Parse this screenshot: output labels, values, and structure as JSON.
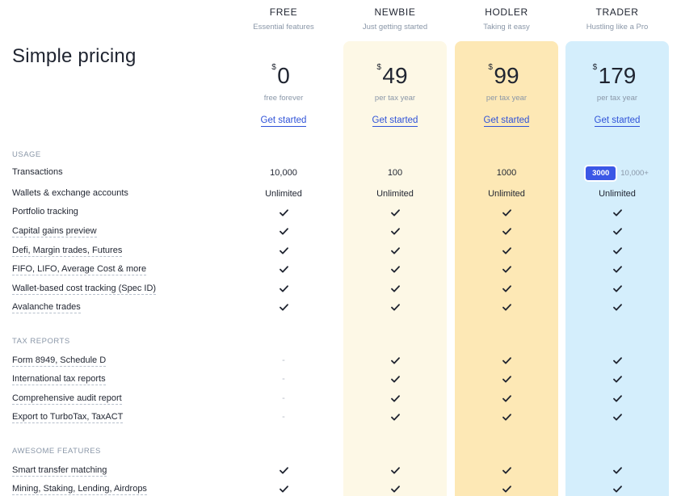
{
  "page": {
    "title": "Simple pricing"
  },
  "plans": [
    {
      "name": "FREE",
      "tagline": "Essential features",
      "currency": "$",
      "price": "0",
      "period": "free forever",
      "cta": "Get started"
    },
    {
      "name": "NEWBIE",
      "tagline": "Just getting started",
      "currency": "$",
      "price": "49",
      "period": "per tax year",
      "cta": "Get started"
    },
    {
      "name": "HODLER",
      "tagline": "Taking it easy",
      "currency": "$",
      "price": "99",
      "period": "per tax year",
      "cta": "Get started"
    },
    {
      "name": "TRADER",
      "tagline": "Hustling like a Pro",
      "currency": "$",
      "price": "179",
      "period": "per tax year",
      "cta": "Get started"
    }
  ],
  "sections": {
    "usage": "USAGE",
    "tax_reports": "TAX REPORTS",
    "awesome": "AWESOME FEATURES"
  },
  "usage_rows": [
    {
      "label": "Transactions",
      "values": [
        "10,000",
        "100",
        "1000",
        ""
      ]
    },
    {
      "label": "Wallets & exchange accounts",
      "values": [
        "Unlimited",
        "Unlimited",
        "Unlimited",
        "Unlimited"
      ]
    },
    {
      "label": "Portfolio tracking",
      "values": [
        "check",
        "check",
        "check",
        "check"
      ]
    },
    {
      "label": "Capital gains preview",
      "values": [
        "check",
        "check",
        "check",
        "check"
      ]
    },
    {
      "label": "Defi, Margin trades, Futures",
      "values": [
        "check",
        "check",
        "check",
        "check"
      ]
    },
    {
      "label": "FIFO, LIFO, Average Cost & more",
      "values": [
        "check",
        "check",
        "check",
        "check"
      ]
    },
    {
      "label": "Wallet-based cost tracking (Spec ID)",
      "values": [
        "check",
        "check",
        "check",
        "check"
      ]
    },
    {
      "label": "Avalanche trades",
      "values": [
        "check",
        "check",
        "check",
        "check"
      ]
    }
  ],
  "trader_transactions": {
    "selected": "3000",
    "next": "10,000+"
  },
  "tax_rows": [
    {
      "label": "Form 8949, Schedule D",
      "values": [
        "-",
        "check",
        "check",
        "check"
      ]
    },
    {
      "label": "International tax reports",
      "values": [
        "-",
        "check",
        "check",
        "check"
      ]
    },
    {
      "label": "Comprehensive audit report",
      "values": [
        "-",
        "check",
        "check",
        "check"
      ]
    },
    {
      "label": "Export to TurboTax, TaxACT",
      "values": [
        "-",
        "check",
        "check",
        "check"
      ]
    }
  ],
  "awesome_rows": [
    {
      "label": "Smart transfer matching",
      "values": [
        "check",
        "check",
        "check",
        "check"
      ]
    },
    {
      "label": "Mining, Staking, Lending, Airdrops",
      "values": [
        "check",
        "check",
        "check",
        "check"
      ]
    }
  ],
  "icons": {
    "check": "check-icon",
    "dash": "dash"
  },
  "colors": {
    "newbie_bg": "#fdf8e6",
    "hodler_bg": "#fde8b5",
    "trader_bg": "#d4eefc",
    "link": "#2f52d8",
    "pill": "#3b57e6",
    "muted": "#8a97a8"
  }
}
